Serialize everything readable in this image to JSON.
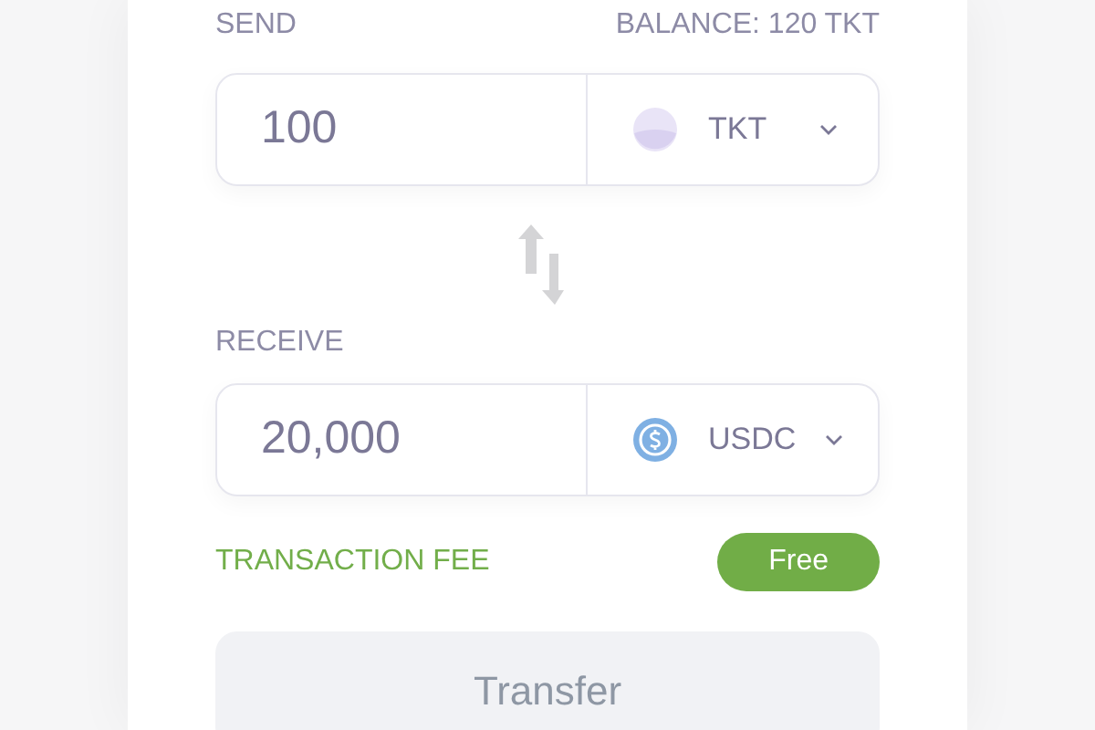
{
  "send": {
    "label": "SEND",
    "balance": "BALANCE: 120 TKT",
    "amount": "100",
    "token": {
      "kind": "plain",
      "symbol": "TKT"
    }
  },
  "receive": {
    "label": "RECEIVE",
    "amount": "20,000",
    "token": {
      "kind": "usdc",
      "symbol": "USDC"
    }
  },
  "fee": {
    "label": "TRANSACTION FEE",
    "badge": "Free"
  },
  "button": {
    "label": "Transfer",
    "disabled": true
  }
}
